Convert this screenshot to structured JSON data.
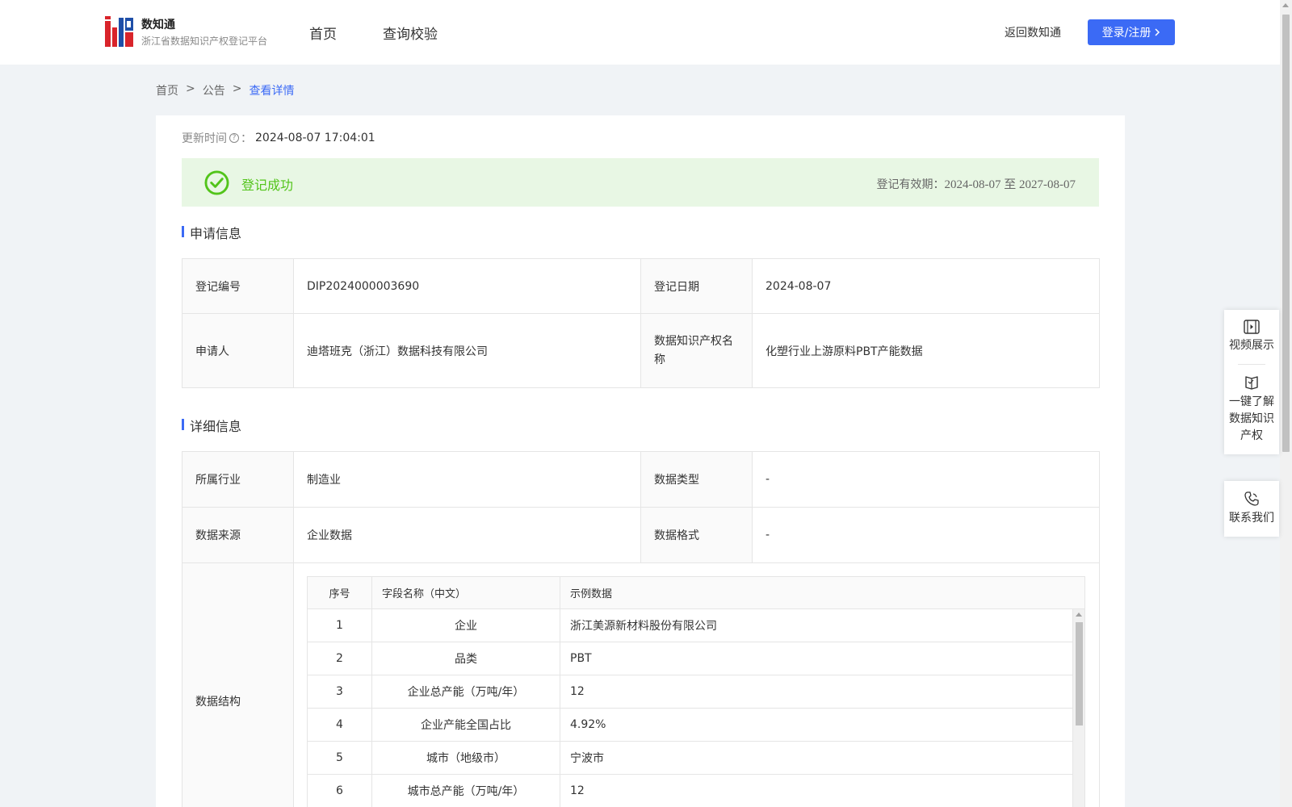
{
  "header": {
    "brand_name": "数知通",
    "brand_sub": "浙江省数据知识产权登记平台",
    "nav": [
      "首页",
      "查询校验"
    ],
    "back_link": "返回数知通",
    "login_label": "登录/注册"
  },
  "breadcrumb": {
    "items": [
      "首页",
      "公告",
      "查看详情"
    ],
    "separator": ">"
  },
  "update": {
    "label": "更新时间",
    "value": "2024-08-07 17:04:01"
  },
  "status": {
    "text": "登记成功",
    "validity_label": "登记有效期：",
    "validity_value": "2024-08-07 至 2027-08-07",
    "color": "#52c41a"
  },
  "application": {
    "title": "申请信息",
    "rows": [
      {
        "label1": "登记编号",
        "value1": "DIP2024000003690",
        "label2": "登记日期",
        "value2": "2024-08-07"
      },
      {
        "label1": "申请人",
        "value1": "迪塔班克（浙江）数据科技有限公司",
        "label2": "数据知识产权名称",
        "value2": "化塑行业上游原料PBT产能数据"
      }
    ]
  },
  "details": {
    "title": "详细信息",
    "rows": [
      {
        "label1": "所属行业",
        "value1": "制造业",
        "label2": "数据类型",
        "value2": "-"
      },
      {
        "label1": "数据来源",
        "value1": "企业数据",
        "label2": "数据格式",
        "value2": "-"
      }
    ],
    "structure_label": "数据结构",
    "structure": {
      "headers": [
        "序号",
        "字段名称（中文）",
        "示例数据"
      ],
      "rows": [
        {
          "no": "1",
          "field": "企业",
          "sample": "浙江美源新材料股份有限公司"
        },
        {
          "no": "2",
          "field": "品类",
          "sample": "PBT"
        },
        {
          "no": "3",
          "field": "企业总产能（万吨/年）",
          "sample": "12"
        },
        {
          "no": "4",
          "field": "企业产能全国占比",
          "sample": "4.92%"
        },
        {
          "no": "5",
          "field": "城市（地级市）",
          "sample": "宁波市"
        },
        {
          "no": "6",
          "field": "城市总产能（万吨/年）",
          "sample": "12"
        }
      ]
    }
  },
  "side_panel": {
    "items": [
      "视频展示",
      "一键了解数据知识产权",
      "联系我们"
    ]
  },
  "colors": {
    "accent": "#3b6af5",
    "success_bg": "#e8f7e4"
  }
}
